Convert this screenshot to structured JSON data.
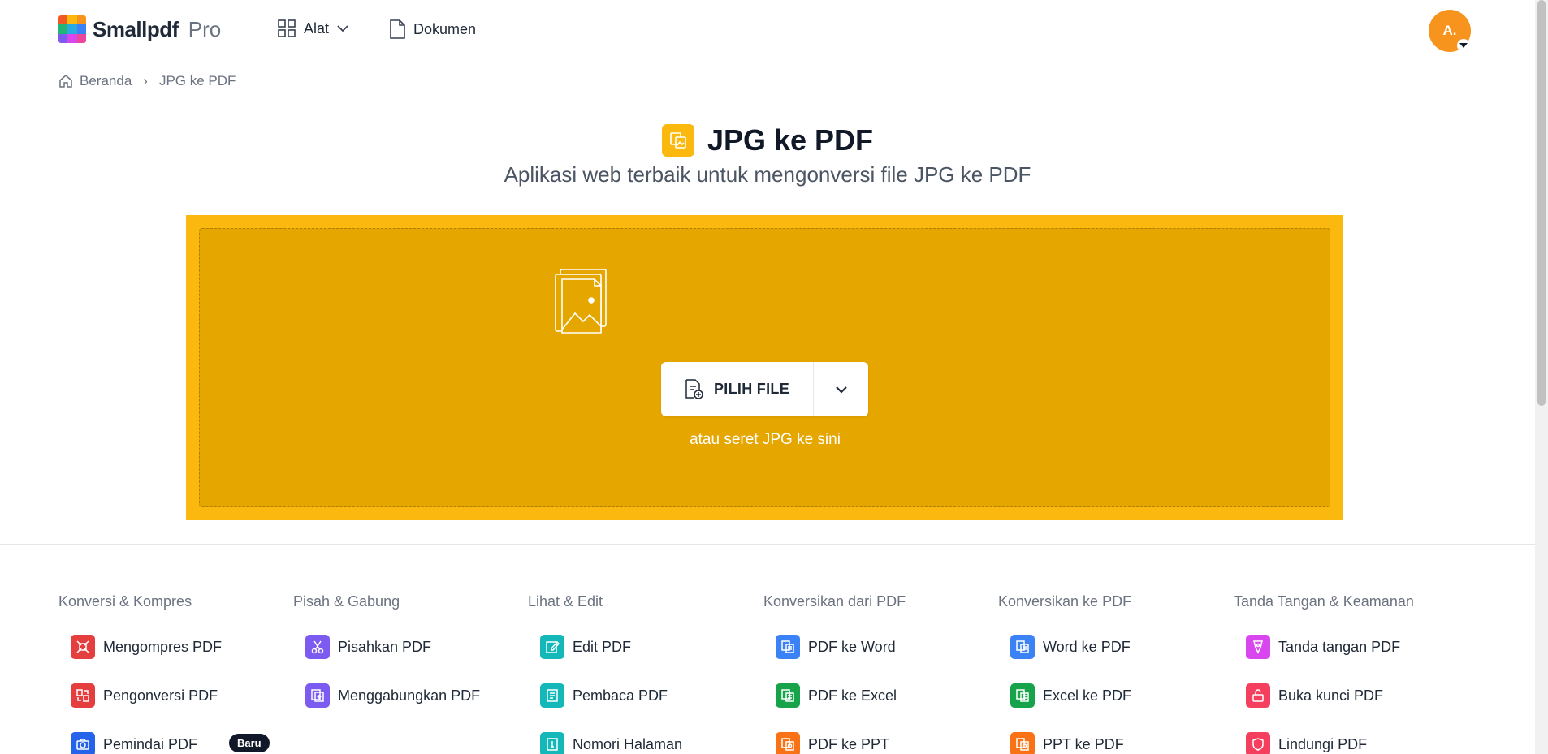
{
  "brand": {
    "name": "Smallpdf",
    "tier": "Pro"
  },
  "nav": {
    "tools_label": "Alat",
    "documents_label": "Dokumen"
  },
  "user": {
    "initials": "A."
  },
  "breadcrumb": {
    "home": "Beranda",
    "separator": "›",
    "current": "JPG ke PDF"
  },
  "hero": {
    "title": "JPG ke PDF",
    "subtitle": "Aplikasi web terbaik untuk mengonversi file JPG ke PDF"
  },
  "dropzone": {
    "button_label": "PILIH FILE",
    "hint": "atau seret JPG ke sini"
  },
  "colors": {
    "accent": "#fbb80f",
    "dropzone_inner": "#e6a600",
    "avatar": "#f7941d"
  },
  "tool_columns": [
    {
      "title": "Konversi & Kompres",
      "items": [
        {
          "label": "Mengompres PDF",
          "icon": "compress-icon",
          "color": "#e53e3e"
        },
        {
          "label": "Pengonversi PDF",
          "icon": "convert-icon",
          "color": "#e53e3e"
        },
        {
          "label": "Pemindai PDF",
          "icon": "camera-icon",
          "color": "#2563eb",
          "badge": "Baru"
        }
      ]
    },
    {
      "title": "Pisah & Gabung",
      "items": [
        {
          "label": "Pisahkan PDF",
          "icon": "scissors-icon",
          "color": "#7c5cf0"
        },
        {
          "label": "Menggabungkan PDF",
          "icon": "merge-icon",
          "color": "#7c5cf0"
        }
      ]
    },
    {
      "title": "Lihat & Edit",
      "items": [
        {
          "label": "Edit PDF",
          "icon": "edit-icon",
          "color": "#14b8b8"
        },
        {
          "label": "Pembaca PDF",
          "icon": "reader-icon",
          "color": "#14b8b8"
        },
        {
          "label": "Nomori Halaman",
          "icon": "numbering-icon",
          "color": "#14b8b8"
        }
      ]
    },
    {
      "title": "Konversikan dari PDF",
      "items": [
        {
          "label": "PDF ke Word",
          "icon": "word-icon",
          "color": "#3b82f6"
        },
        {
          "label": "PDF ke Excel",
          "icon": "excel-icon",
          "color": "#16a34a"
        },
        {
          "label": "PDF ke PPT",
          "icon": "ppt-icon",
          "color": "#f97316"
        }
      ]
    },
    {
      "title": "Konversikan ke PDF",
      "items": [
        {
          "label": "Word ke PDF",
          "icon": "word-icon",
          "color": "#3b82f6"
        },
        {
          "label": "Excel ke PDF",
          "icon": "excel-icon",
          "color": "#16a34a"
        },
        {
          "label": "PPT ke PDF",
          "icon": "ppt-icon",
          "color": "#f97316"
        }
      ]
    },
    {
      "title": "Tanda Tangan & Keamanan",
      "items": [
        {
          "label": "Tanda tangan PDF",
          "icon": "sign-icon",
          "color": "#d946ef"
        },
        {
          "label": "Buka kunci PDF",
          "icon": "unlock-icon",
          "color": "#f43f5e"
        },
        {
          "label": "Lindungi PDF",
          "icon": "shield-icon",
          "color": "#f43f5e"
        }
      ]
    }
  ]
}
